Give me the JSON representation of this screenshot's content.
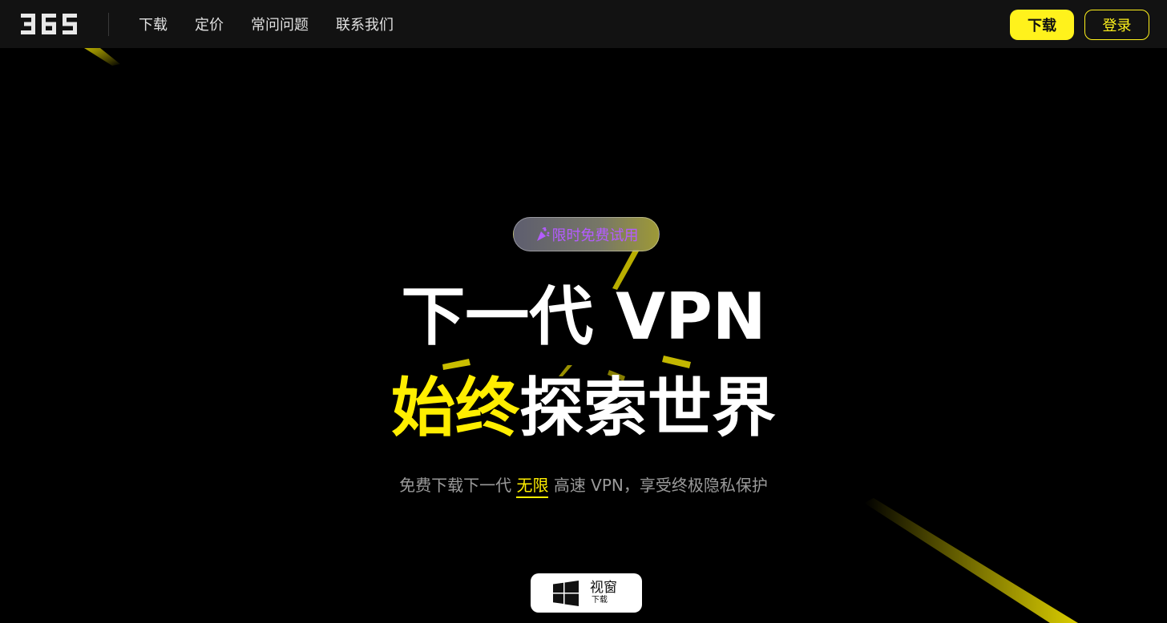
{
  "header": {
    "logo_text": "365",
    "nav": [
      {
        "label": "下载"
      },
      {
        "label": "定价"
      },
      {
        "label": "常问问题"
      },
      {
        "label": "联系我们"
      }
    ],
    "download_label": "下载",
    "login_label": "登录"
  },
  "hero": {
    "badge_text": "限时免费试用",
    "title_line1": "下一代 VPN",
    "title_line2_highlight": "始终",
    "title_line2_rest": "探索世界",
    "subtitle_pre": "免费下载下一代 ",
    "subtitle_highlight": "无限",
    "subtitle_post": " 高速 VPN，享受终极隐私保护",
    "windows_button": {
      "label": "视窗",
      "sublabel": "下载"
    }
  },
  "colors": {
    "accent": "#fff21c",
    "header_bg": "#121212",
    "page_bg": "#000000",
    "badge_text": "#b45cff"
  }
}
